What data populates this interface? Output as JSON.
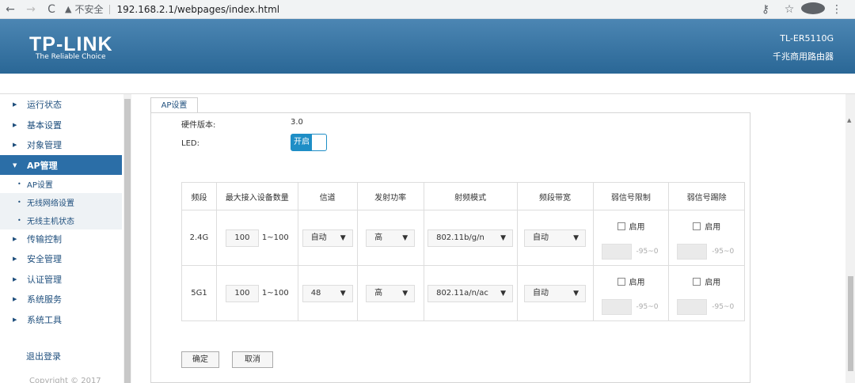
{
  "browser": {
    "security": "不安全",
    "url": "192.168.2.1/webpages/index.html"
  },
  "header": {
    "logo": "TP-LINK",
    "tagline": "The Reliable Choice",
    "model": "TL-ER5110G",
    "product": "千兆商用路由器"
  },
  "sidebar": {
    "items": [
      {
        "label": "运行状态"
      },
      {
        "label": "基本设置"
      },
      {
        "label": "对象管理"
      },
      {
        "label": "AP管理"
      },
      {
        "label": "传输控制"
      },
      {
        "label": "安全管理"
      },
      {
        "label": "认证管理"
      },
      {
        "label": "系统服务"
      },
      {
        "label": "系统工具"
      }
    ],
    "subitems": [
      {
        "label": "AP设置"
      },
      {
        "label": "无线网络设置"
      },
      {
        "label": "无线主机状态"
      }
    ],
    "logout": "退出登录",
    "copyright": "Copyright © 2017"
  },
  "tab": {
    "label": "AP设置"
  },
  "form": {
    "hw_label": "硬件版本:",
    "hw_value": "3.0",
    "led_label": "LED:",
    "led_state": "开启"
  },
  "table": {
    "headers": [
      "频段",
      "最大接入设备数量",
      "信道",
      "发射功率",
      "射频模式",
      "频段带宽",
      "弱信号限制",
      "弱信号踢除"
    ],
    "rows": [
      {
        "band": "2.4G",
        "max": "100",
        "range": "1~100",
        "channel": "自动",
        "power": "高",
        "mode": "802.11b/g/n",
        "bw": "自动",
        "limit_label": "启用",
        "limit_range": "-95~0",
        "kick_label": "启用",
        "kick_range": "-95~0"
      },
      {
        "band": "5G1",
        "max": "100",
        "range": "1~100",
        "channel": "48",
        "power": "高",
        "mode": "802.11a/n/ac",
        "bw": "自动",
        "limit_label": "启用",
        "limit_range": "-95~0",
        "kick_label": "启用",
        "kick_range": "-95~0"
      }
    ]
  },
  "buttons": {
    "ok": "确定",
    "cancel": "取消"
  },
  "colors": {
    "header": "#2a6796",
    "accent": "#1e8ec6",
    "active_menu": "#2b6ea7"
  }
}
